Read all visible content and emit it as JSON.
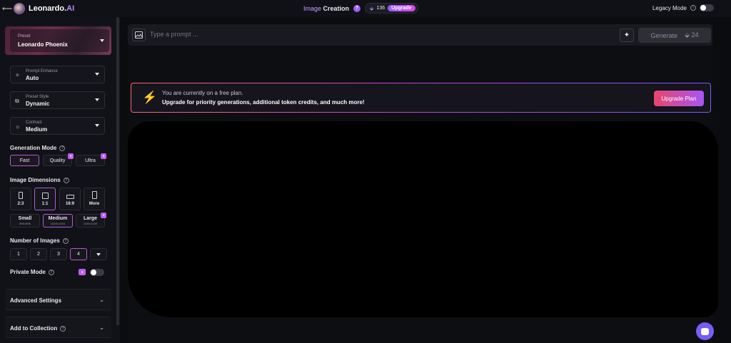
{
  "header": {
    "back_icon": "arrow-left-icon",
    "brand": "Leonardo.",
    "brand_ai": "AI",
    "title_highlight": "Image",
    "title_rest": "Creation",
    "help": "?",
    "token_count": "136",
    "upgrade_label": "Upgrade",
    "legacy_label": "Legacy Mode",
    "legacy_on": false
  },
  "sidebar": {
    "preset": {
      "small": "Preset",
      "value": "Leonardo Phoenix"
    },
    "prompt_enhance": {
      "small": "Prompt Enhance",
      "value": "Auto"
    },
    "preset_style": {
      "small": "Preset Style",
      "value": "Dynamic"
    },
    "contrast": {
      "small": "Contrast",
      "value": "Medium"
    },
    "generation_mode": {
      "label": "Generation Mode",
      "options": [
        "Fast",
        "Quality",
        "Ultra"
      ],
      "selected": "Fast"
    },
    "image_dimensions": {
      "label": "Image Dimensions",
      "ratios": [
        "2:3",
        "1:1",
        "16:9",
        "More"
      ],
      "selected_ratio": "1:1",
      "sizes": [
        {
          "label": "Small",
          "sub": "896×896"
        },
        {
          "label": "Medium",
          "sub": "1024×1024"
        },
        {
          "label": "Large",
          "sub": "1100×1100"
        }
      ],
      "selected_size": "Medium"
    },
    "number_of_images": {
      "label": "Number of Images",
      "options": [
        "1",
        "2",
        "3",
        "4"
      ],
      "selected": "4"
    },
    "private_mode": {
      "label": "Private Mode",
      "on": false
    },
    "advanced_settings": "Advanced Settings",
    "add_to_collection": "Add to Collection"
  },
  "prompt": {
    "placeholder": "Type a prompt ...",
    "generate_label": "Generate",
    "generate_cost": "24"
  },
  "banner": {
    "line1": "You are currently on a free plan.",
    "line2": "Upgrade for priority generations, additional token credits, and much more!",
    "button": "Upgrade Plan"
  },
  "colors": {
    "accent": "#9b5cf6",
    "selected_border": "#b05cd8",
    "bolt": "#f08a3c"
  }
}
